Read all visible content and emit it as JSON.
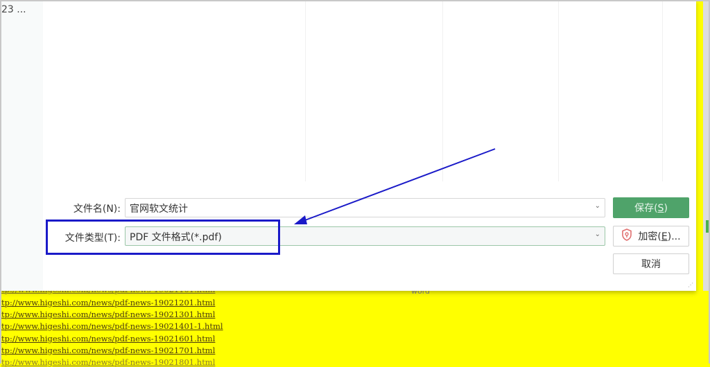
{
  "background": {
    "breadcrumb": "23 ...",
    "links": [
      "tp://www.higeshi.com/news/pdf-news-19021101.html",
      "tp://www.higeshi.com/news/pdf-news-19021201.html",
      "tp://www.higeshi.com/news/pdf-news-19021301.html",
      "tp://www.higeshi.com/news/pdf-news-19021401-1.html",
      "tp://www.higeshi.com/news/pdf-news-19021601.html",
      "tp://www.higeshi.com/news/pdf-news-19021701.html",
      "tp://www.higeshi.com/news/pdf-news-19021801.html"
    ],
    "cell_text": "word"
  },
  "dialog": {
    "filename_label": "文件名(N):",
    "filename_value": "官网软文统计",
    "filetype_label": "文件类型(T):",
    "filetype_value": "PDF 文件格式(*.pdf)",
    "save": {
      "text": "保存(",
      "key": "S",
      "end": ")"
    },
    "encrypt": {
      "text": "加密(",
      "key": "E",
      "end": ")..."
    },
    "cancel": "取消"
  },
  "colors": {
    "primary": "#4fa36a",
    "highlight": "#1a1ac8",
    "sheet": "#ffff00"
  }
}
